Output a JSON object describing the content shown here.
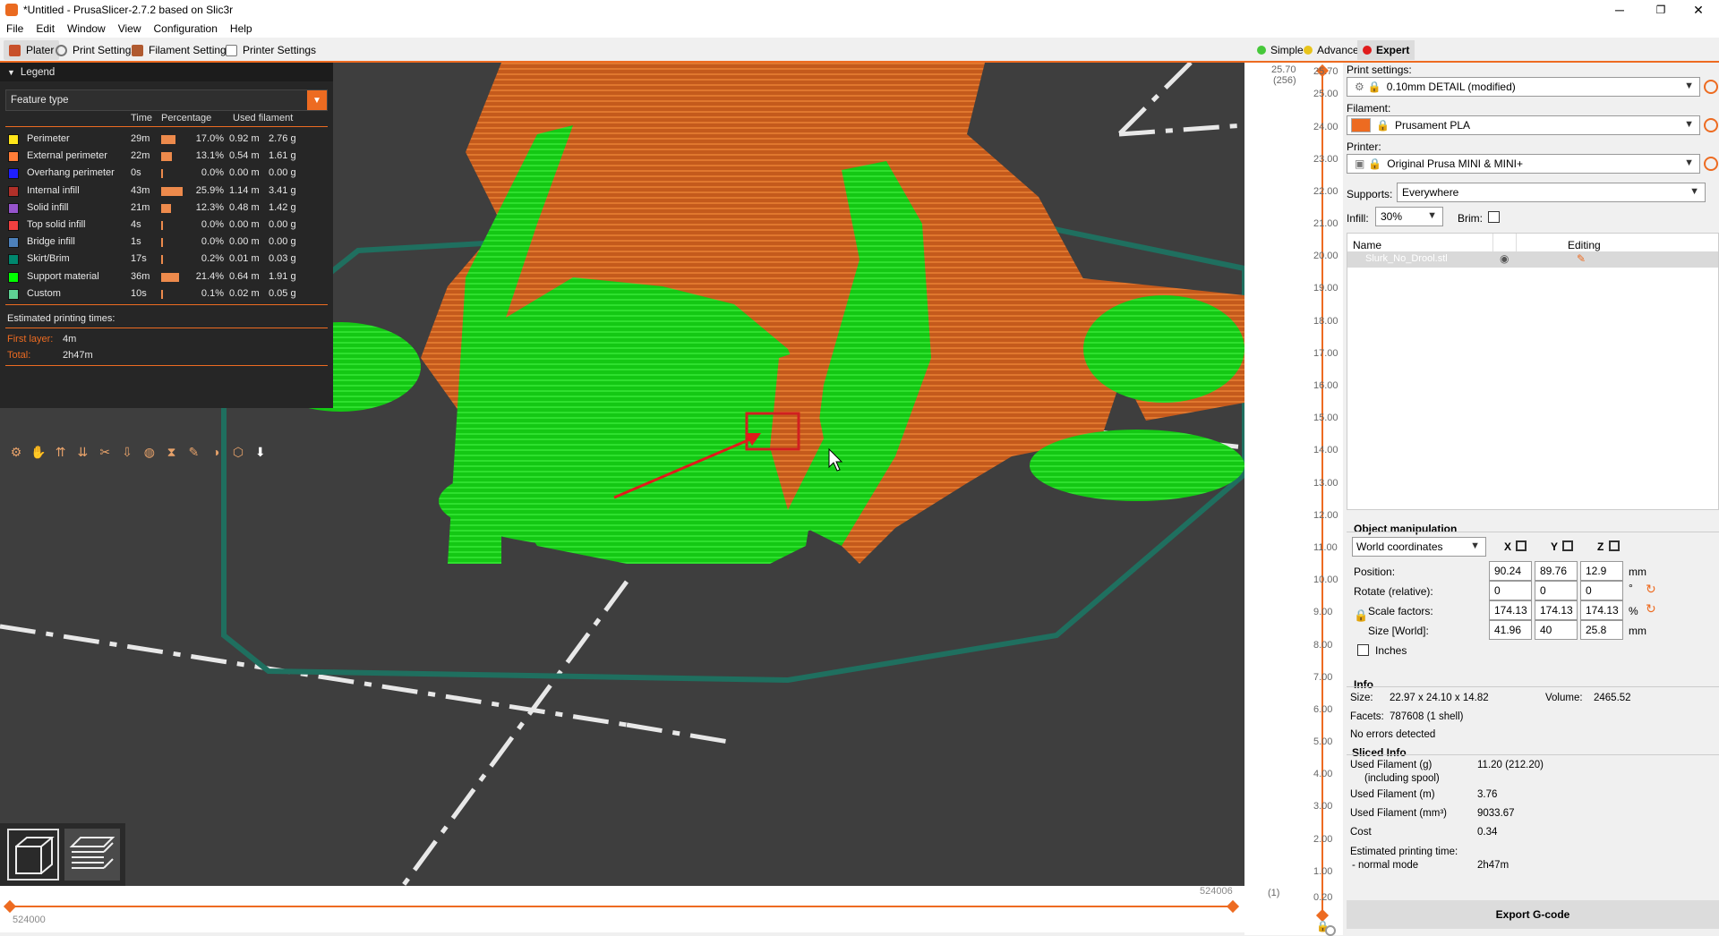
{
  "window": {
    "title": "*Untitled - PrusaSlicer-2.7.2 based on Slic3r",
    "min": "─",
    "max": "❐",
    "close": "✕"
  },
  "menu": [
    "File",
    "Edit",
    "Window",
    "View",
    "Configuration",
    "Help"
  ],
  "tabs": {
    "plater": "Plater",
    "print": "Print Settings",
    "filament": "Filament Settings",
    "printer": "Printer Settings"
  },
  "modes": {
    "simple": "Simple",
    "advanced": "Advanced",
    "expert": "Expert"
  },
  "colors": {
    "accent": "#ed6b21",
    "simple": "#46c83a",
    "advanced": "#e8c41c",
    "expert": "#e01b1b"
  },
  "legend": {
    "title": "Legend",
    "combo": "Feature type",
    "cols": {
      "time": "Time",
      "percentage": "Percentage",
      "filament": "Used filament"
    },
    "rows": [
      {
        "name": "Perimeter",
        "color": "#ffe619",
        "time": "29m",
        "pct": 17.0,
        "pct_label": "17.0%",
        "m": "0.92 m",
        "g": "2.76 g"
      },
      {
        "name": "External perimeter",
        "color": "#ff7d38",
        "time": "22m",
        "pct": 13.1,
        "pct_label": "13.1%",
        "m": "0.54 m",
        "g": "1.61 g"
      },
      {
        "name": "Overhang perimeter",
        "color": "#1f1fff",
        "time": "0s",
        "pct": 0.0,
        "pct_label": "0.0%",
        "m": "0.00 m",
        "g": "0.00 g"
      },
      {
        "name": "Internal infill",
        "color": "#b03029",
        "time": "43m",
        "pct": 25.9,
        "pct_label": "25.9%",
        "m": "1.14 m",
        "g": "3.41 g"
      },
      {
        "name": "Solid infill",
        "color": "#9654cc",
        "time": "21m",
        "pct": 12.3,
        "pct_label": "12.3%",
        "m": "0.48 m",
        "g": "1.42 g"
      },
      {
        "name": "Top solid infill",
        "color": "#f04040",
        "time": "4s",
        "pct": 0.0,
        "pct_label": "0.0%",
        "m": "0.00 m",
        "g": "0.00 g"
      },
      {
        "name": "Bridge infill",
        "color": "#4d80ba",
        "time": "1s",
        "pct": 0.0,
        "pct_label": "0.0%",
        "m": "0.00 m",
        "g": "0.00 g"
      },
      {
        "name": "Skirt/Brim",
        "color": "#00876e",
        "time": "17s",
        "pct": 0.2,
        "pct_label": "0.2%",
        "m": "0.01 m",
        "g": "0.03 g"
      },
      {
        "name": "Support material",
        "color": "#00ff00",
        "time": "36m",
        "pct": 21.4,
        "pct_label": "21.4%",
        "m": "0.64 m",
        "g": "1.91 g"
      },
      {
        "name": "Custom",
        "color": "#5ed194",
        "time": "10s",
        "pct": 0.1,
        "pct_label": "0.1%",
        "m": "0.02 m",
        "g": "0.05 g"
      }
    ],
    "est_title": "Estimated printing times:",
    "first_layer_label": "First layer:",
    "first_layer": "4m",
    "total_label": "Total:",
    "total": "2h47m"
  },
  "ruler": {
    "top_value": "25.70",
    "top_layer": "(256)",
    "ticks": [
      "25.70",
      "25.00",
      "24.00",
      "23.00",
      "22.00",
      "21.00",
      "20.00",
      "19.00",
      "18.00",
      "17.00",
      "16.00",
      "15.00",
      "14.00",
      "13.00",
      "12.00",
      "11.00",
      "10.00",
      "9.00",
      "8.00",
      "7.00",
      "6.00",
      "5.00",
      "4.00",
      "3.00",
      "2.00",
      "1.00",
      "0.20"
    ],
    "bottom_layer": "(1)"
  },
  "hslider": {
    "left_value": "524000",
    "right_value": "524006"
  },
  "panel": {
    "print_label": "Print settings:",
    "print_value": "0.10mm DETAIL (modified)",
    "filament_label": "Filament:",
    "filament_value": "Prusament PLA",
    "filament_color": "#ed6b21",
    "printer_label": "Printer:",
    "printer_value": "Original Prusa MINI & MINI+",
    "supports_label": "Supports:",
    "supports_value": "Everywhere",
    "infill_label": "Infill:",
    "infill_value": "30%",
    "brim_label": "Brim:",
    "list_name_col": "Name",
    "list_edit_col": "Editing",
    "object_name": "Slurk_No_Drool.stl",
    "om_title": "Object manipulation",
    "coord_system": "World coordinates",
    "axis_x": "X",
    "axis_y": "Y",
    "axis_z": "Z",
    "position_label": "Position:",
    "position": [
      "90.24",
      "89.76",
      "12.9"
    ],
    "position_unit": "mm",
    "rotate_label": "Rotate (relative):",
    "rotate": [
      "0",
      "0",
      "0"
    ],
    "rotate_unit": "°",
    "scale_label": "Scale factors:",
    "scale": [
      "174.13",
      "174.13",
      "174.13"
    ],
    "scale_unit": "%",
    "size_label": "Size [World]:",
    "size": [
      "41.96",
      "40",
      "25.8"
    ],
    "size_unit": "mm",
    "inches_label": "Inches",
    "info_title": "Info",
    "size_info_label": "Size:",
    "size_info": "22.97 x 24.10 x 14.82",
    "volume_label": "Volume:",
    "volume": "2465.52",
    "facets_label": "Facets:",
    "facets": "787608 (1 shell)",
    "errors": "No errors detected",
    "sliced_title": "Sliced Info",
    "used_g_label": "Used Filament (g)",
    "used_g_sub": "(including spool)",
    "used_g": "11.20 (212.20)",
    "used_m_label": "Used Filament (m)",
    "used_m": "3.76",
    "used_mm3_label": "Used Filament (mm³)",
    "used_mm3": "9033.67",
    "cost_label": "Cost",
    "cost": "0.34",
    "est_label": "Estimated printing time:",
    "est_mode": "- normal mode",
    "est_time": "2h47m",
    "export": "Export G-code"
  }
}
